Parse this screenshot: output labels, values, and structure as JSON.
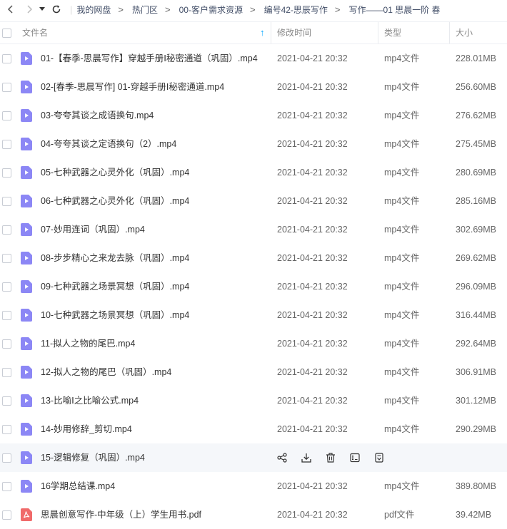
{
  "breadcrumb": [
    "我的网盘",
    "热门区",
    "00-客户需求资源",
    "编号42-思辰写作",
    "写作——01 思晨一阶 春"
  ],
  "columns": {
    "name": "文件名",
    "modified": "修改时间",
    "type": "类型",
    "size": "大小",
    "sort_indicator": "↑"
  },
  "hover_row_index": 14,
  "files": [
    {
      "icon": "video-file-icon",
      "name": "01-【春季-思晨写作】穿越手册Ⅰ秘密通道（巩固）.mp4",
      "date": "2021-04-21 20:32",
      "type": "mp4文件",
      "size": "228.01MB"
    },
    {
      "icon": "video-file-icon",
      "name": "02-[春季-思晨写作] 01-穿越手册Ⅰ秘密通道.mp4",
      "date": "2021-04-21 20:32",
      "type": "mp4文件",
      "size": "256.60MB"
    },
    {
      "icon": "video-file-icon",
      "name": "03-夸夸其谈之成语换句.mp4",
      "date": "2021-04-21 20:32",
      "type": "mp4文件",
      "size": "276.62MB"
    },
    {
      "icon": "video-file-icon",
      "name": "04-夸夸其谈之定语换句（2）.mp4",
      "date": "2021-04-21 20:32",
      "type": "mp4文件",
      "size": "275.45MB"
    },
    {
      "icon": "video-file-icon",
      "name": "05-七种武器之心灵外化（巩固）.mp4",
      "date": "2021-04-21 20:32",
      "type": "mp4文件",
      "size": "280.69MB"
    },
    {
      "icon": "video-file-icon",
      "name": "06-七种武器之心灵外化（巩固）.mp4",
      "date": "2021-04-21 20:32",
      "type": "mp4文件",
      "size": "285.16MB"
    },
    {
      "icon": "video-file-icon",
      "name": "07-妙用连词（巩固）.mp4",
      "date": "2021-04-21 20:32",
      "type": "mp4文件",
      "size": "302.69MB"
    },
    {
      "icon": "video-file-icon",
      "name": "08-步步精心之来龙去脉（巩固）.mp4",
      "date": "2021-04-21 20:32",
      "type": "mp4文件",
      "size": "269.62MB"
    },
    {
      "icon": "video-file-icon",
      "name": "09-七种武器之场景冥想（巩固）.mp4",
      "date": "2021-04-21 20:32",
      "type": "mp4文件",
      "size": "296.09MB"
    },
    {
      "icon": "video-file-icon",
      "name": "10-七种武器之场景冥想（巩固）.mp4",
      "date": "2021-04-21 20:32",
      "type": "mp4文件",
      "size": "316.44MB"
    },
    {
      "icon": "video-file-icon",
      "name": "11-拟人之物的尾巴.mp4",
      "date": "2021-04-21 20:32",
      "type": "mp4文件",
      "size": "292.64MB"
    },
    {
      "icon": "video-file-icon",
      "name": "12-拟人之物的尾巴（巩固）.mp4",
      "date": "2021-04-21 20:32",
      "type": "mp4文件",
      "size": "306.91MB"
    },
    {
      "icon": "video-file-icon",
      "name": "13-比喻Ⅰ之比喻公式.mp4",
      "date": "2021-04-21 20:32",
      "type": "mp4文件",
      "size": "301.12MB"
    },
    {
      "icon": "video-file-icon",
      "name": "14-妙用修辞_剪切.mp4",
      "date": "2021-04-21 20:32",
      "type": "mp4文件",
      "size": "290.29MB"
    },
    {
      "icon": "video-file-icon",
      "name": "15-逻辑修复（巩固）.mp4",
      "date": "",
      "type": "",
      "size": ""
    },
    {
      "icon": "video-file-icon",
      "name": "16学期总结课.mp4",
      "date": "2021-04-21 20:32",
      "type": "mp4文件",
      "size": "389.80MB"
    },
    {
      "icon": "pdf-file-icon",
      "name": "思晨创意写作-中年级（上）学生用书.pdf",
      "date": "2021-04-21 20:32",
      "type": "pdf文件",
      "size": "39.42MB"
    }
  ],
  "hover_actions": [
    "share-icon",
    "download-icon",
    "delete-icon",
    "rename-icon",
    "more-icon"
  ],
  "colors": {
    "video_icon": "#8c87f5",
    "pdf_icon": "#f06a6a",
    "accent": "#06a7ff",
    "hover_bg": "#f5f7fa"
  }
}
